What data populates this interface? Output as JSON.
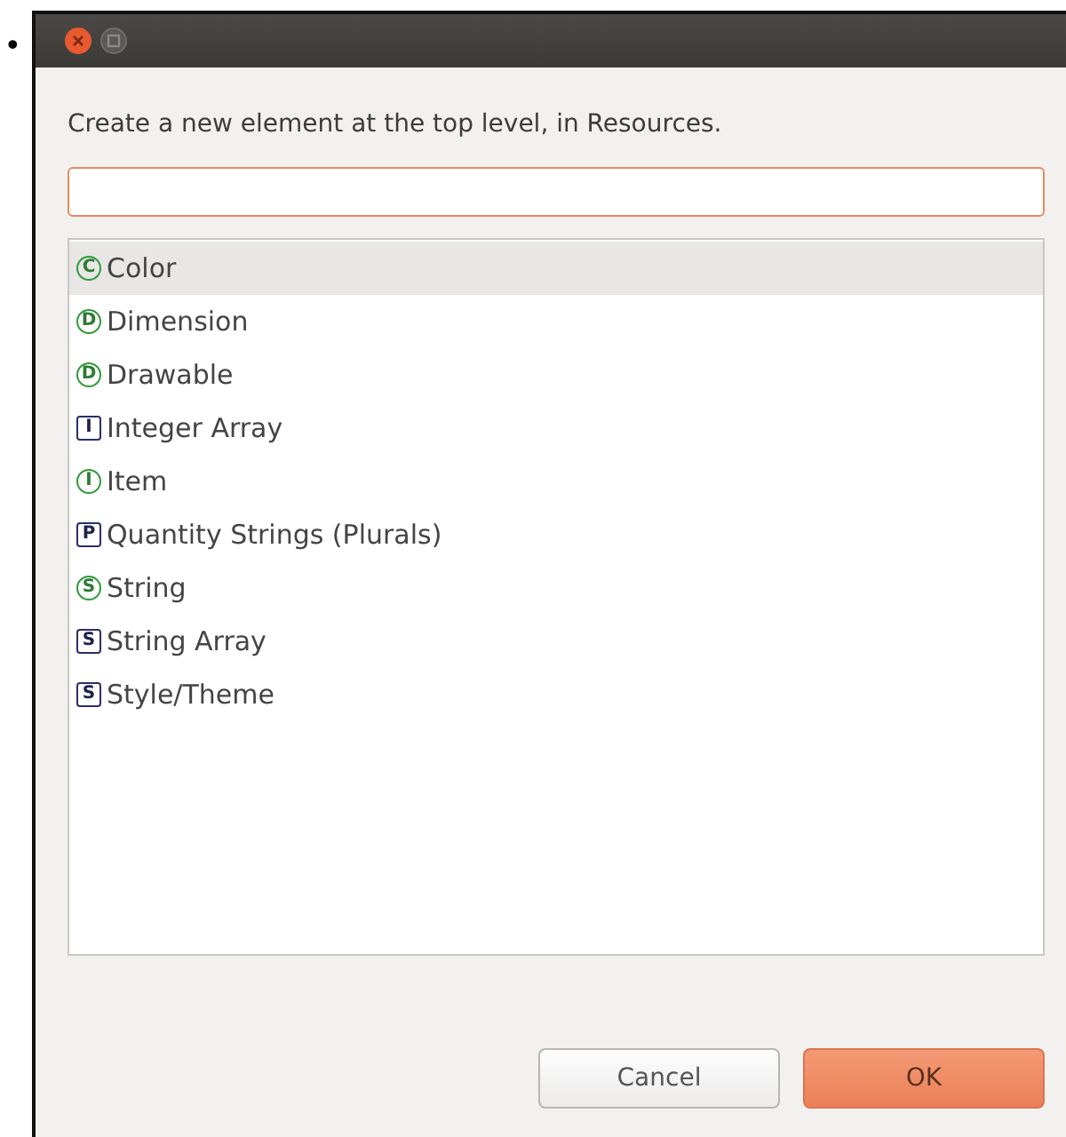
{
  "bullet": "•",
  "dialog": {
    "prompt": "Create a new element at the top level, in Resources.",
    "items": [
      {
        "icon": "C",
        "kind": "circle",
        "label": "Color",
        "selected": true
      },
      {
        "icon": "D",
        "kind": "circle",
        "label": "Dimension",
        "selected": false
      },
      {
        "icon": "D",
        "kind": "circle",
        "label": "Drawable",
        "selected": false
      },
      {
        "icon": "I",
        "kind": "square",
        "label": "Integer Array",
        "selected": false
      },
      {
        "icon": "I",
        "kind": "circle",
        "label": "Item",
        "selected": false
      },
      {
        "icon": "P",
        "kind": "square",
        "label": "Quantity Strings (Plurals)",
        "selected": false
      },
      {
        "icon": "S",
        "kind": "circle",
        "label": "String",
        "selected": false
      },
      {
        "icon": "S",
        "kind": "square",
        "label": "String Array",
        "selected": false
      },
      {
        "icon": "S",
        "kind": "square",
        "label": "Style/Theme",
        "selected": false
      }
    ],
    "buttons": [
      {
        "label": "Cancel",
        "kind": "secondary"
      },
      {
        "label": "OK",
        "kind": "primary"
      }
    ]
  }
}
